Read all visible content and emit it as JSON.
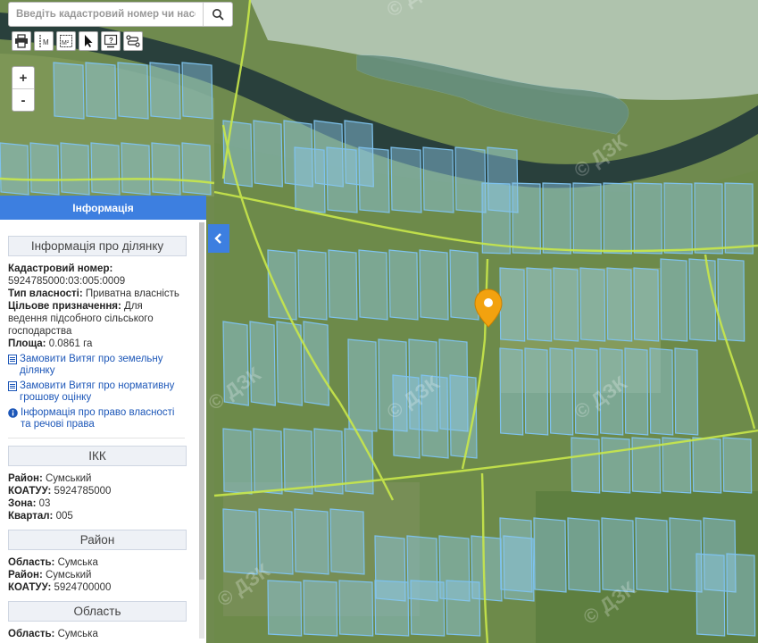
{
  "search": {
    "placeholder": "Введіть кадастровий номер чи населе"
  },
  "toolbar": {
    "tools": [
      "print-icon",
      "measure-distance-icon",
      "measure-area-icon",
      "pointer-icon",
      "identify-icon",
      "layers-icon"
    ]
  },
  "zoom": {
    "in": "+",
    "out": "-"
  },
  "colors": {
    "accent": "#3d7fe0",
    "parcel": "#8ec9ea",
    "marker": "#f2a20f",
    "road": "#c9e84a"
  },
  "panel": {
    "title": "Інформація",
    "parcel": {
      "header": "Інформація про ділянку",
      "cadastral_label": "Кадастровий номер:",
      "cadastral_value": "5924785000:03:005:0009",
      "ownership_label": "Тип власності:",
      "ownership_value": "Приватна власність",
      "purpose_label": "Цільове призначення:",
      "purpose_value": "Для ведення підсобного сільського господарства",
      "area_label": "Площа:",
      "area_value": "0.0861 га",
      "link_extract": "Замовити Витяг про земельну ділянку",
      "link_valuation": "Замовити Витяг про нормативну грошову оцінку",
      "link_rights": "Інформація про право власності та речові права"
    },
    "ikk": {
      "header": "ІКК",
      "district_label": "Район:",
      "district_value": "Сумський",
      "koatuu_label": "КОАТУУ:",
      "koatuu_value": "5924785000",
      "zone_label": "Зона:",
      "zone_value": "03",
      "quarter_label": "Квартал:",
      "quarter_value": "005"
    },
    "district": {
      "header": "Район",
      "region_label": "Область:",
      "region_value": "Сумська",
      "district_label": "Район:",
      "district_value": "Сумський",
      "koatuu_label": "КОАТУУ:",
      "koatuu_value": "5924700000"
    },
    "region": {
      "header": "Область",
      "region_label": "Область:",
      "region_value": "Сумська"
    }
  }
}
